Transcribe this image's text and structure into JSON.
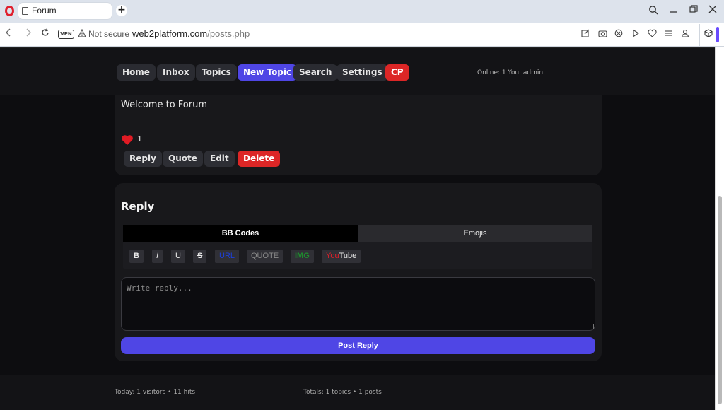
{
  "browser": {
    "tab_title": "Forum",
    "new_tab_symbol": "+",
    "vpn_label": "VPN",
    "security_label": "Not secure",
    "url_host": "web2platform.com",
    "url_path": "/posts.php",
    "accent_color": "#6a4cff"
  },
  "header": {
    "nav": [
      {
        "label": "Home"
      },
      {
        "label": "Inbox"
      },
      {
        "label": "Topics"
      },
      {
        "label": "New Topic"
      },
      {
        "label": "Search"
      },
      {
        "label": "Settings"
      },
      {
        "label": "CP"
      }
    ],
    "online_status": "Online: 1 You: admin"
  },
  "post": {
    "text": "Welcome to Forum",
    "like_count": "1",
    "actions": [
      {
        "label": "Reply"
      },
      {
        "label": "Quote"
      },
      {
        "label": "Edit"
      },
      {
        "label": "Delete"
      }
    ]
  },
  "reply": {
    "title": "Reply",
    "tabs": [
      {
        "label": "BB Codes"
      },
      {
        "label": "Emojis"
      }
    ],
    "bbcodes": [
      {
        "label": "B"
      },
      {
        "label": "I"
      },
      {
        "label": "U"
      },
      {
        "label": "S"
      },
      {
        "label": "URL"
      },
      {
        "label": "QUOTE"
      },
      {
        "label": "IMG"
      }
    ],
    "youtube_part1": "You",
    "youtube_part2": "Tube",
    "placeholder": "Write reply...",
    "submit_label": "Post Reply"
  },
  "footer": {
    "visitors": "Today: 1 visitors • 11 hits",
    "totals": "Totals: 1 topics • 1 posts"
  },
  "colors": {
    "primary": "#4f46e5",
    "danger": "#dc2626",
    "background": "#0d0d10",
    "card": "#18181b"
  }
}
